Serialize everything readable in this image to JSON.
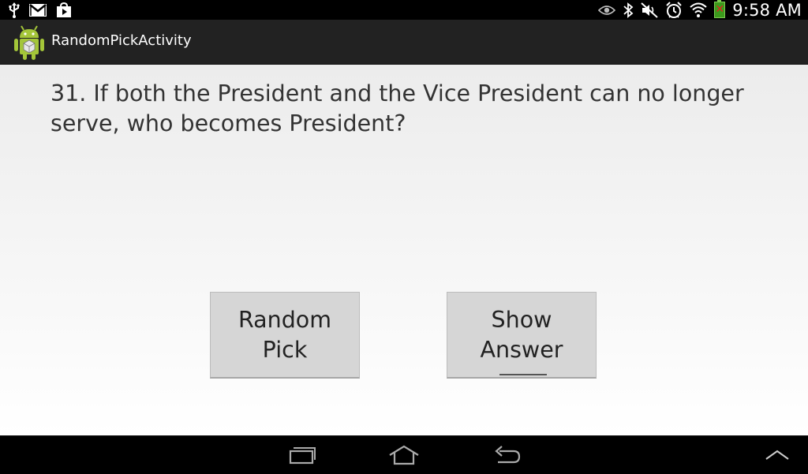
{
  "status_bar": {
    "time": "9:58 AM",
    "left_icons": [
      "usb-icon",
      "gmail-icon",
      "play-store-icon"
    ],
    "right_icons": [
      "eye-icon",
      "bluetooth-icon",
      "mute-icon",
      "alarm-icon",
      "wifi-icon",
      "battery-icon"
    ]
  },
  "action_bar": {
    "title": "RandomPickActivity",
    "app_icon": "android-icon"
  },
  "main": {
    "question": "31. If both the President and the Vice President can no longer serve, who becomes President?",
    "random_pick_label": "Random\nPick",
    "show_answer_label": "Show\nAnswer"
  },
  "nav_bar": {
    "buttons": [
      "recent-apps-icon",
      "home-icon",
      "back-icon",
      "menu-up-icon"
    ]
  }
}
